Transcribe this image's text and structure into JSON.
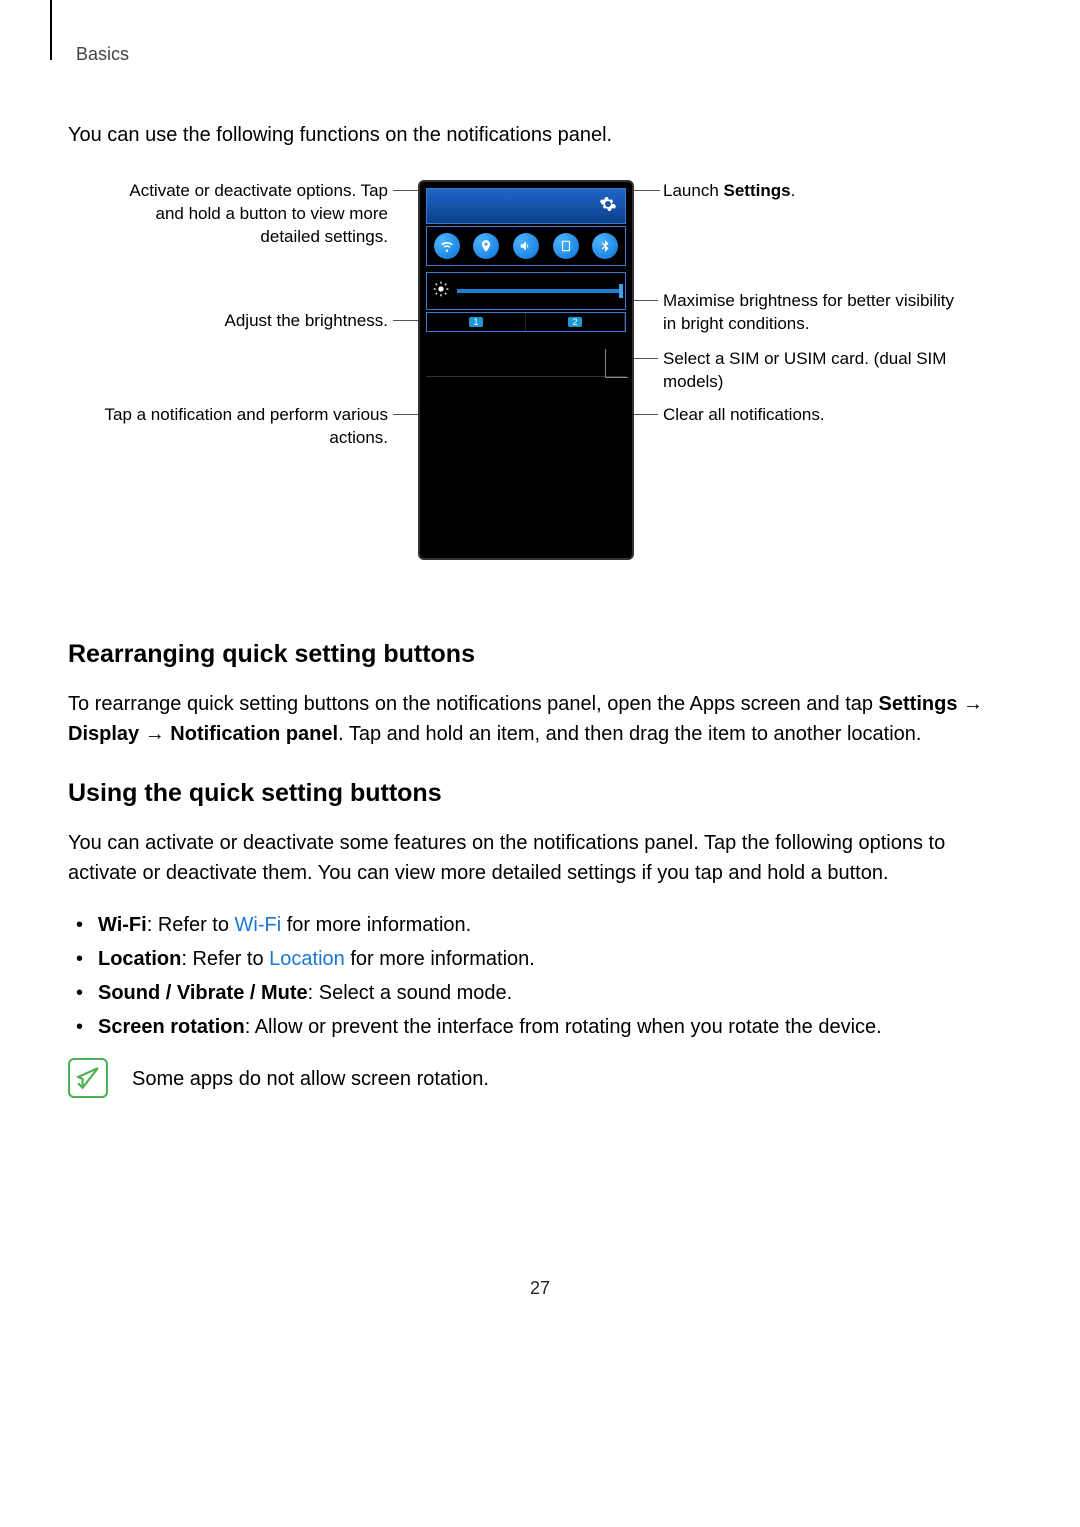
{
  "header": {
    "section": "Basics"
  },
  "intro": "You can use the following functions on the notifications panel.",
  "callouts": {
    "leftTop": "Activate or deactivate options. Tap and hold a button to view more detailed settings.",
    "leftBright": "Adjust the brightness.",
    "leftNotif": "Tap a notification and perform various actions.",
    "rightSettings_pre": "Launch ",
    "rightSettings_bold": "Settings",
    "rightSettings_post": ".",
    "rightMax": "Maximise brightness for better visibility in bright conditions.",
    "rightSim": "Select a SIM or USIM card. (dual SIM models)",
    "rightClear": "Clear all notifications."
  },
  "toggles": [
    "wifi-icon",
    "location-icon",
    "sound-icon",
    "rotation-icon",
    "bluetooth-icon"
  ],
  "sim": {
    "one": "1",
    "two": "2"
  },
  "sections": {
    "rearrange": {
      "title": "Rearranging quick setting buttons",
      "text_pre": "To rearrange quick setting buttons on the notifications panel, open the Apps screen and tap ",
      "bold1": "Settings",
      "arrow": " → ",
      "bold2": "Display",
      "bold3": "Notification panel",
      "text_post": ". Tap and hold an item, and then drag the item to another location."
    },
    "using": {
      "title": "Using the quick setting buttons",
      "text": "You can activate or deactivate some features on the notifications panel. Tap the following options to activate or deactivate them. You can view more detailed settings if you tap and hold a button."
    }
  },
  "bullets": {
    "wifi_b": "Wi-Fi",
    "wifi_t1": ": Refer to ",
    "wifi_link": "Wi-Fi",
    "wifi_t2": " for more information.",
    "loc_b": "Location",
    "loc_t1": ": Refer to ",
    "loc_link": "Location",
    "loc_t2": " for more information.",
    "snd_b": "Sound / Vibrate / Mute",
    "snd_t": ": Select a sound mode.",
    "rot_b": "Screen rotation",
    "rot_t": ": Allow or prevent the interface from rotating when you rotate the device."
  },
  "note": "Some apps do not allow screen rotation.",
  "page": "27"
}
